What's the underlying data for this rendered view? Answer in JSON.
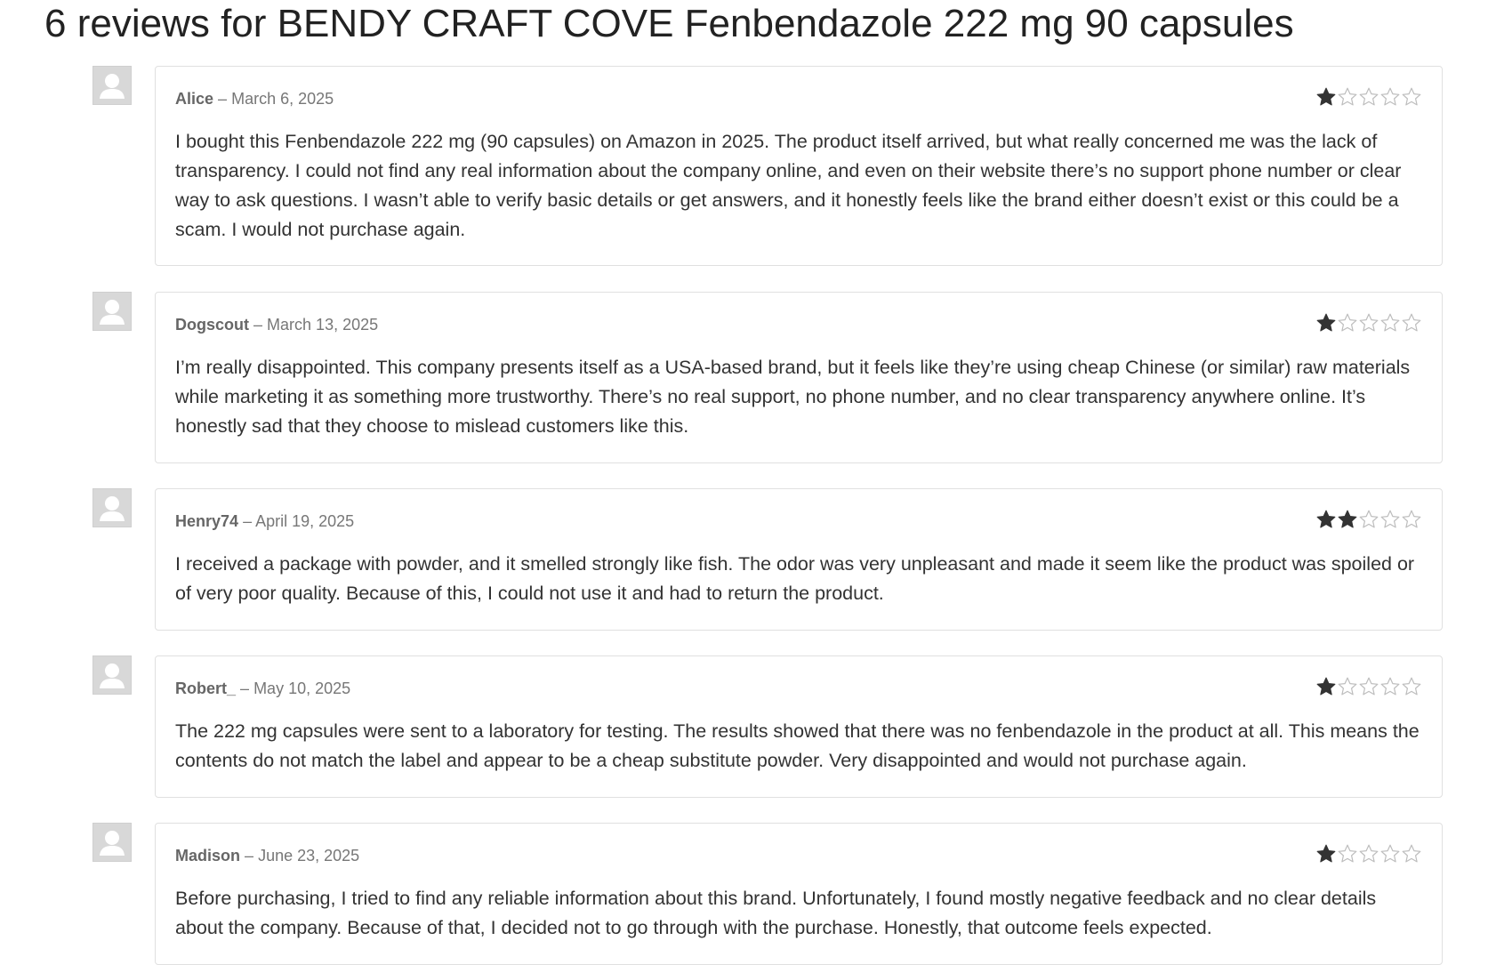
{
  "page": {
    "title": "6 reviews for BENDY CRAFT COVE Fenbendazole 222 mg 90 capsules"
  },
  "meta_separator": "–",
  "icons": {
    "avatar": "user-avatar-icon",
    "star_filled": "star-filled-icon",
    "star_empty": "star-empty-icon"
  },
  "colors": {
    "star_filled": "#333333",
    "star_empty": "#bdbdbd"
  },
  "reviews": [
    {
      "author": "Alice",
      "date": "March 6, 2025",
      "rating": 1,
      "max_rating": 5,
      "text": "I bought this Fenbendazole 222 mg (90 capsules) on Amazon in 2025. The product itself arrived, but what really concerned me was the lack of transparency. I could not find any real information about the company online, and even on their website there’s no support phone number or clear way to ask questions. I wasn’t able to verify basic details or get answers, and it honestly feels like the brand either doesn’t exist or this could be a scam. I would not purchase again."
    },
    {
      "author": "Dogscout",
      "date": "March 13, 2025",
      "rating": 1,
      "max_rating": 5,
      "text": "I’m really disappointed. This company presents itself as a USA-based brand, but it feels like they’re using cheap Chinese (or similar) raw materials while marketing it as something more trustworthy. There’s no real support, no phone number, and no clear transparency anywhere online. It’s honestly sad that they choose to mislead customers like this."
    },
    {
      "author": "Henry74",
      "date": "April 19, 2025",
      "rating": 2,
      "max_rating": 5,
      "text": "I received a package with powder, and it smelled strongly like fish. The odor was very unpleasant and made it seem like the product was spoiled or of very poor quality. Because of this, I could not use it and had to return the product."
    },
    {
      "author": "Robert_",
      "date": "May 10, 2025",
      "rating": 1,
      "max_rating": 5,
      "text": "The 222 mg capsules were sent to a laboratory for testing. The results showed that there was no fenbendazole in the product at all. This means the contents do not match the label and appear to be a cheap substitute powder. Very disappointed and would not purchase again."
    },
    {
      "author": "Madison",
      "date": "June 23, 2025",
      "rating": 1,
      "max_rating": 5,
      "text": "Before purchasing, I tried to find any reliable information about this brand. Unfortunately, I found mostly negative feedback and no clear details about the company. Because of that, I decided not to go through with the purchase. Honestly, that outcome feels expected."
    }
  ]
}
